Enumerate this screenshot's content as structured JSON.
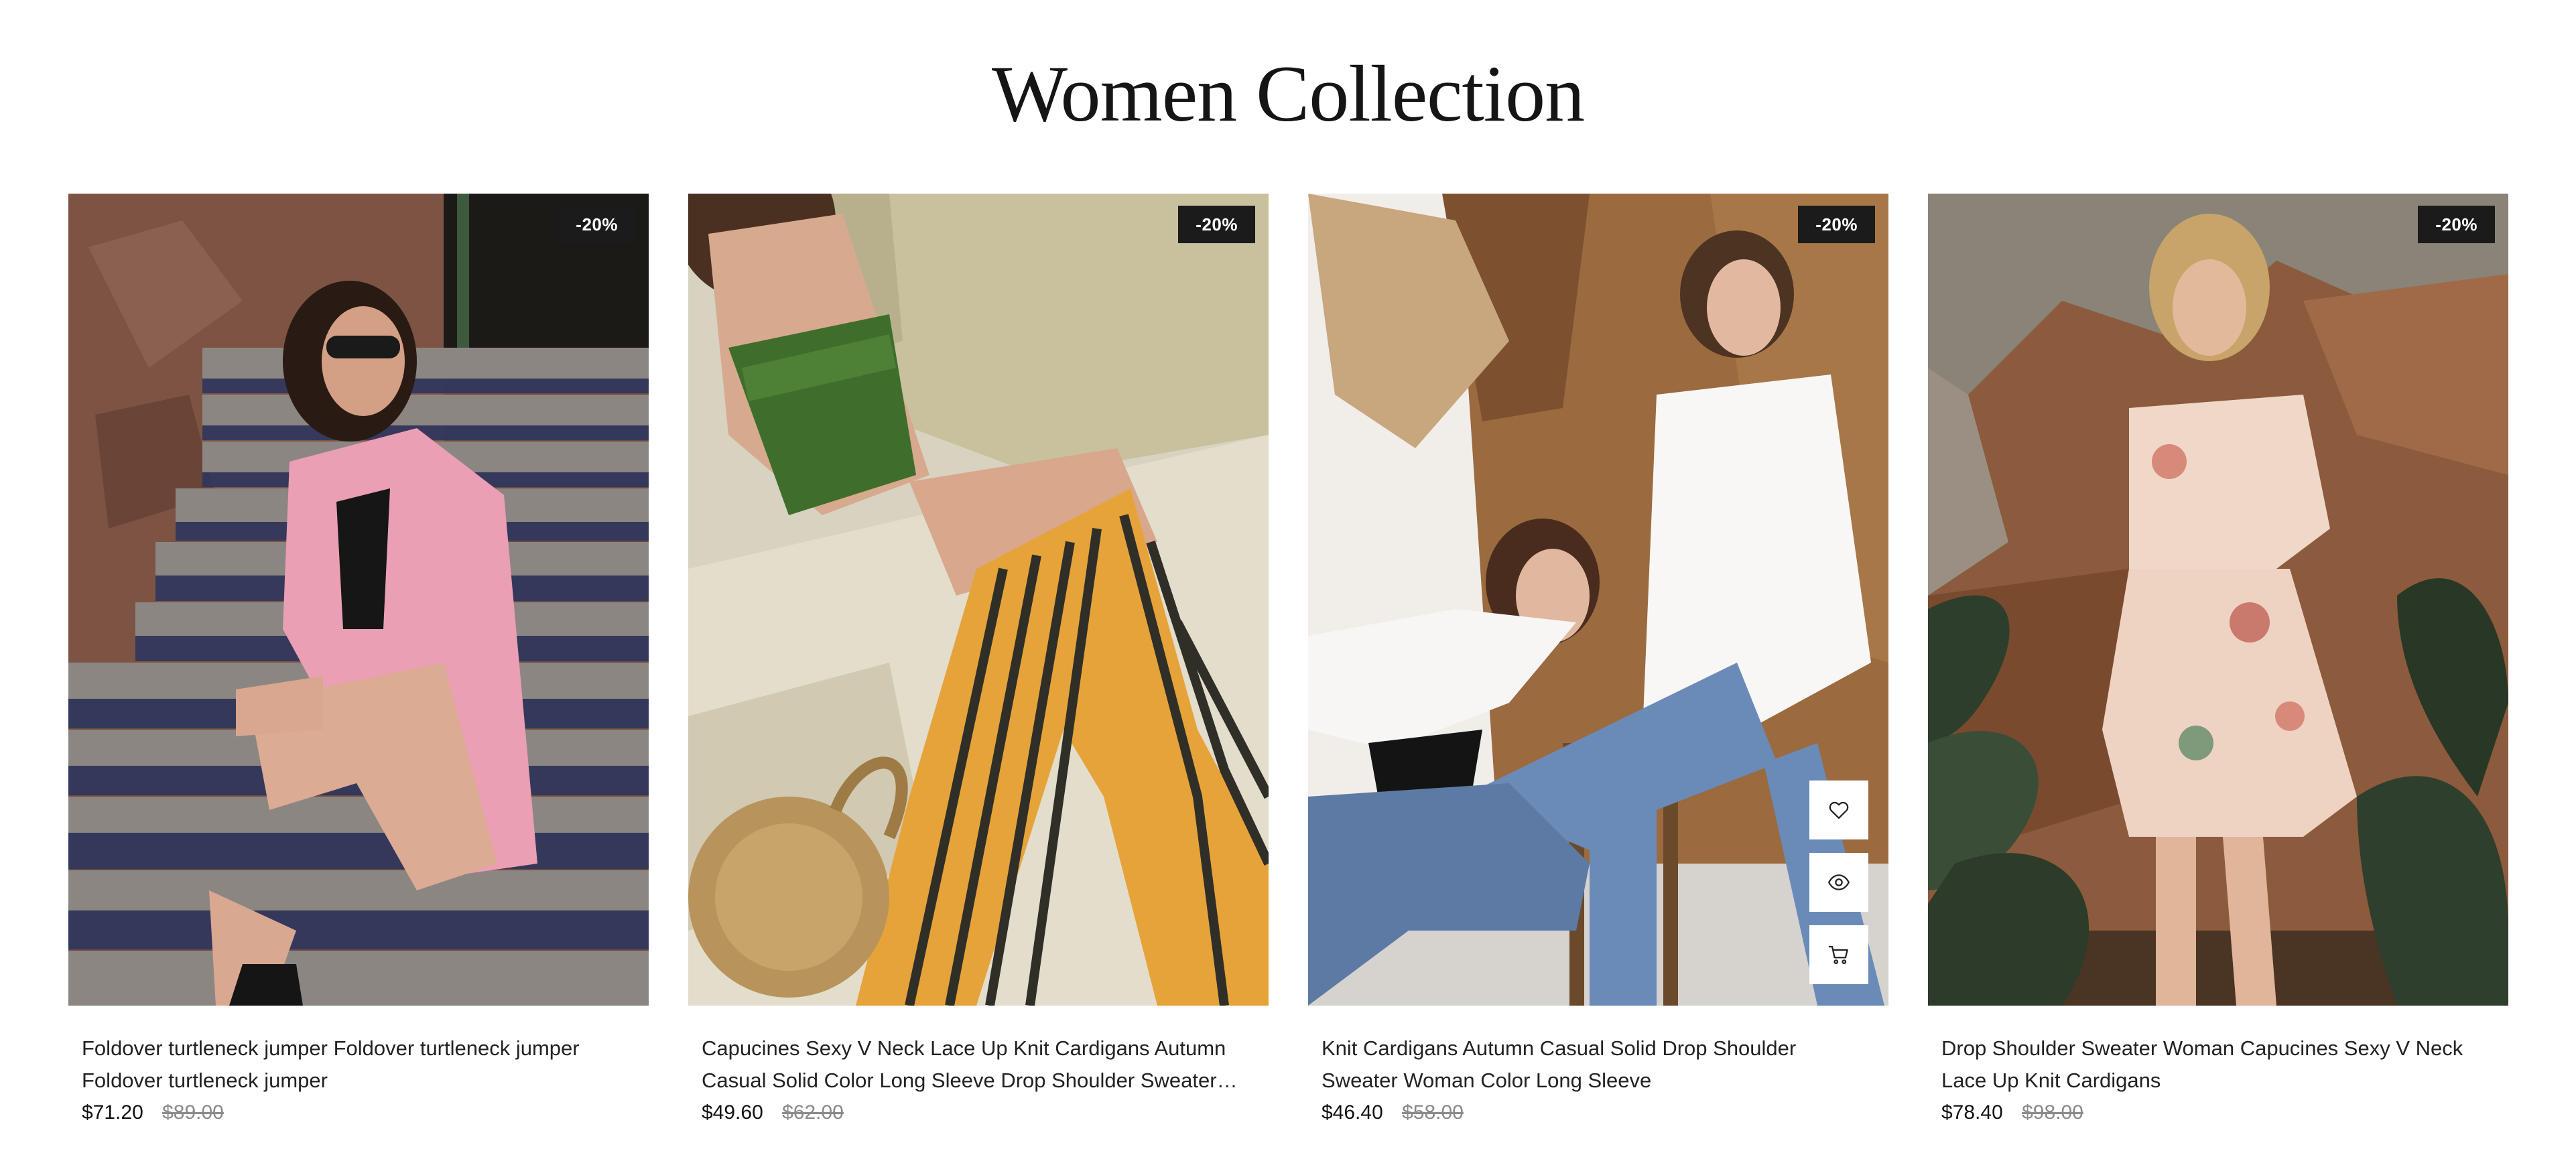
{
  "section": {
    "title": "Women Collection"
  },
  "products": [
    {
      "badge": "-20%",
      "title": "Foldover turtleneck jumper Foldover turtleneck jumper Foldover turtleneck jumper",
      "price": "$71.20",
      "old_price": "$89.00",
      "image": "woman-pink-blazer-on-tiled-stairs"
    },
    {
      "badge": "-20%",
      "title": "Capucines Sexy V Neck Lace Up Knit Cardigans Autumn Casual Solid Color Long Sleeve Drop Shoulder Sweater Woman",
      "price": "$49.60",
      "old_price": "$62.00",
      "image": "woman-striped-pants-lying-on-bed"
    },
    {
      "badge": "-20%",
      "title": "Knit Cardigans Autumn Casual Solid Drop Shoulder Sweater Woman Color Long Sleeve",
      "price": "$46.40",
      "old_price": "$58.00",
      "image": "two-women-white-shirts-denim",
      "actions": {
        "wishlist_icon": "heart-icon",
        "quickview_icon": "eye-icon",
        "cart_icon": "cart-icon"
      }
    },
    {
      "badge": "-20%",
      "title": "Drop Shoulder Sweater Woman Capucines Sexy V Neck Lace Up Knit Cardigans",
      "price": "$78.40",
      "old_price": "$98.00",
      "image": "woman-floral-dress-by-wall"
    }
  ],
  "colors": {
    "badge_bg": "#1b1b1b",
    "badge_text": "#ffffff",
    "old_price": "#8a8a8a"
  }
}
